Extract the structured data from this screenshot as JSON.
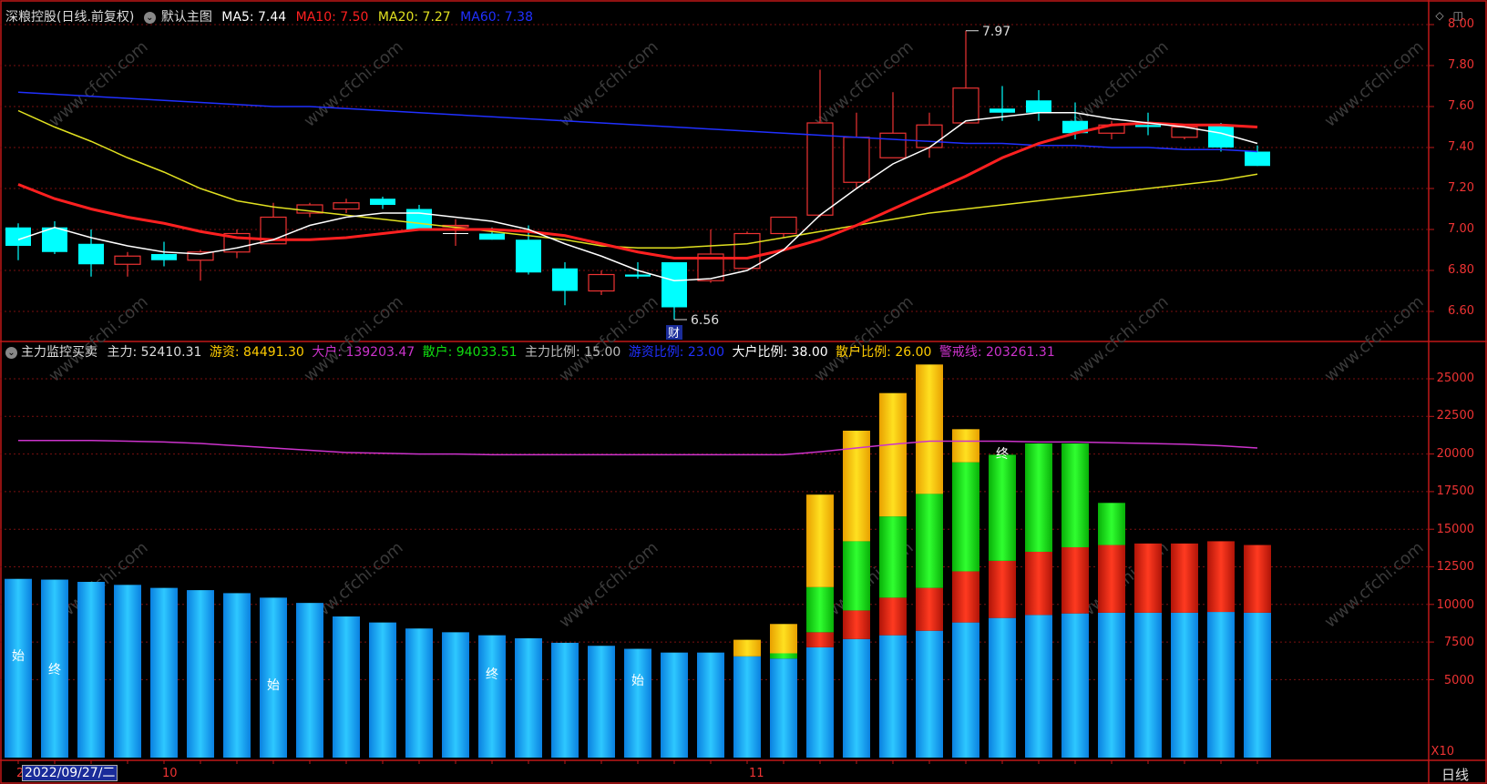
{
  "header": {
    "stock": "深粮控股",
    "period_desc": "(日线.前复权)",
    "template": "默认主图",
    "ma5": "MA5: 7.44",
    "ma10": "MA10: 7.50",
    "ma20": "MA20: 7.27",
    "ma60": "MA60: 7.38"
  },
  "indicator": {
    "name": "主力监控买卖",
    "zhuli": "主力: 52410.31",
    "youzi": "游资: 84491.30",
    "dahu": "大户: 139203.47",
    "sanhu": "散户: 94033.51",
    "zhuli_ratio": "主力比例: 15.00",
    "youzi_ratio": "游资比例: 23.00",
    "dahu_ratio": "大户比例: 38.00",
    "sanhu_ratio": "散户比例: 26.00",
    "alert": "警戒线: 203261.31"
  },
  "price_axis": [
    "8.00",
    "7.80",
    "7.60",
    "7.40",
    "7.20",
    "7.00",
    "6.80",
    "6.60"
  ],
  "vol_axis": [
    "25000",
    "22500",
    "20000",
    "17500",
    "15000",
    "12500",
    "10000",
    "7500",
    "5000"
  ],
  "annotations": {
    "high": "7.97",
    "low": "6.56",
    "cai": "财",
    "start": "始",
    "end": "终",
    "x10": "X10"
  },
  "footer": {
    "date": "2022/09/27/二",
    "m1": "10",
    "m2": "11",
    "period": "日线",
    "left_mark": "2"
  },
  "watermark": "www.cfchi.com",
  "colors": {
    "up": "#e33",
    "down": "#00ffff",
    "ma5": "#ffffff",
    "ma10": "#ff2020",
    "ma20": "#e0e020",
    "ma60": "#2030ff",
    "main": "#1ea8ff",
    "red": "#e82010",
    "green": "#10dd10",
    "yellow": "#ffcc00",
    "alert": "#cc33cc"
  },
  "chart_data": [
    {
      "type": "candlestick",
      "ylim": [
        6.5,
        8.05
      ],
      "candles": [
        {
          "o": 7.01,
          "h": 7.03,
          "l": 6.85,
          "c": 6.92
        },
        {
          "o": 7.01,
          "h": 7.04,
          "l": 6.88,
          "c": 6.89
        },
        {
          "o": 6.93,
          "h": 7.0,
          "l": 6.77,
          "c": 6.83
        },
        {
          "o": 6.83,
          "h": 6.89,
          "l": 6.77,
          "c": 6.87
        },
        {
          "o": 6.88,
          "h": 6.94,
          "l": 6.82,
          "c": 6.85
        },
        {
          "o": 6.85,
          "h": 6.9,
          "l": 6.75,
          "c": 6.89
        },
        {
          "o": 6.89,
          "h": 7.0,
          "l": 6.86,
          "c": 6.98
        },
        {
          "o": 6.93,
          "h": 7.13,
          "l": 6.93,
          "c": 7.06
        },
        {
          "o": 7.08,
          "h": 7.13,
          "l": 7.06,
          "c": 7.12
        },
        {
          "o": 7.1,
          "h": 7.15,
          "l": 7.08,
          "c": 7.13
        },
        {
          "o": 7.15,
          "h": 7.16,
          "l": 7.1,
          "c": 7.12
        },
        {
          "o": 7.1,
          "h": 7.12,
          "l": 7.0,
          "c": 7.0
        },
        {
          "o": 7.02,
          "h": 7.05,
          "l": 6.92,
          "c": 7.02
        },
        {
          "o": 6.98,
          "h": 7.01,
          "l": 6.95,
          "c": 6.95
        },
        {
          "o": 6.95,
          "h": 7.02,
          "l": 6.78,
          "c": 6.79
        },
        {
          "o": 6.81,
          "h": 6.84,
          "l": 6.63,
          "c": 6.7
        },
        {
          "o": 6.7,
          "h": 6.8,
          "l": 6.68,
          "c": 6.78
        },
        {
          "o": 6.78,
          "h": 6.84,
          "l": 6.76,
          "c": 6.77
        },
        {
          "o": 6.84,
          "h": 6.84,
          "l": 6.56,
          "c": 6.62
        },
        {
          "o": 6.75,
          "h": 7.0,
          "l": 6.74,
          "c": 6.88
        },
        {
          "o": 6.81,
          "h": 6.99,
          "l": 6.81,
          "c": 6.98
        },
        {
          "o": 6.98,
          "h": 7.06,
          "l": 6.96,
          "c": 7.06
        },
        {
          "o": 7.07,
          "h": 7.78,
          "l": 7.06,
          "c": 7.52
        },
        {
          "o": 7.23,
          "h": 7.57,
          "l": 7.2,
          "c": 7.45
        },
        {
          "o": 7.35,
          "h": 7.67,
          "l": 7.35,
          "c": 7.47
        },
        {
          "o": 7.4,
          "h": 7.57,
          "l": 7.35,
          "c": 7.51
        },
        {
          "o": 7.52,
          "h": 7.97,
          "l": 7.52,
          "c": 7.69
        },
        {
          "o": 7.59,
          "h": 7.7,
          "l": 7.53,
          "c": 7.57
        },
        {
          "o": 7.63,
          "h": 7.68,
          "l": 7.53,
          "c": 7.57
        },
        {
          "o": 7.53,
          "h": 7.62,
          "l": 7.44,
          "c": 7.47
        },
        {
          "o": 7.47,
          "h": 7.53,
          "l": 7.44,
          "c": 7.51
        },
        {
          "o": 7.51,
          "h": 7.57,
          "l": 7.46,
          "c": 7.5
        },
        {
          "o": 7.45,
          "h": 7.51,
          "l": 7.44,
          "c": 7.5
        },
        {
          "o": 7.51,
          "h": 7.52,
          "l": 7.38,
          "c": 7.4
        },
        {
          "o": 7.38,
          "h": 7.41,
          "l": 7.31,
          "c": 7.31
        }
      ],
      "ma5": [
        6.95,
        7.01,
        6.96,
        6.92,
        6.89,
        6.88,
        6.91,
        6.95,
        7.02,
        7.06,
        7.08,
        7.08,
        7.06,
        7.04,
        7.0,
        6.93,
        6.87,
        6.8,
        6.75,
        6.76,
        6.8,
        6.9,
        7.07,
        7.2,
        7.32,
        7.4,
        7.53,
        7.55,
        7.57,
        7.57,
        7.54,
        7.52,
        7.5,
        7.47,
        7.42
      ],
      "ma10": [
        7.22,
        7.15,
        7.1,
        7.06,
        7.03,
        6.99,
        6.96,
        6.95,
        6.95,
        6.96,
        6.98,
        7.0,
        7.0,
        7.0,
        6.99,
        6.97,
        6.93,
        6.89,
        6.86,
        6.86,
        6.86,
        6.9,
        6.95,
        7.02,
        7.1,
        7.18,
        7.26,
        7.35,
        7.42,
        7.47,
        7.51,
        7.52,
        7.51,
        7.51,
        7.5
      ],
      "ma20": [
        7.58,
        7.5,
        7.43,
        7.35,
        7.28,
        7.2,
        7.14,
        7.11,
        7.09,
        7.07,
        7.05,
        7.03,
        7.01,
        6.99,
        6.97,
        6.95,
        6.92,
        6.91,
        6.91,
        6.92,
        6.93,
        6.96,
        6.99,
        7.02,
        7.05,
        7.08,
        7.1,
        7.12,
        7.14,
        7.16,
        7.18,
        7.2,
        7.22,
        7.24,
        7.27
      ],
      "ma60": [
        7.67,
        7.66,
        7.65,
        7.64,
        7.63,
        7.62,
        7.61,
        7.6,
        7.6,
        7.59,
        7.58,
        7.57,
        7.56,
        7.55,
        7.54,
        7.53,
        7.52,
        7.51,
        7.5,
        7.49,
        7.48,
        7.47,
        7.46,
        7.45,
        7.44,
        7.43,
        7.42,
        7.42,
        7.41,
        7.41,
        7.4,
        7.4,
        7.39,
        7.39,
        7.38
      ]
    },
    {
      "type": "stacked-bar",
      "ylim": [
        0,
        26500
      ],
      "alert_line": 20800,
      "series": [
        {
          "name": "主力",
          "values": [
            11700,
            11650,
            11500,
            11300,
            11100,
            10950,
            10750,
            10450,
            10100,
            9200,
            8800,
            8400,
            8150,
            7950,
            7750,
            7450,
            7250,
            7050,
            6800,
            6800,
            6550,
            6400,
            7150,
            7700,
            7950,
            8250,
            8800,
            9100,
            9300,
            9400,
            9450,
            9450,
            9450,
            9500,
            9450
          ]
        },
        {
          "name": "大户",
          "values": [
            0,
            0,
            0,
            0,
            0,
            0,
            0,
            0,
            0,
            0,
            0,
            0,
            0,
            0,
            0,
            0,
            0,
            0,
            0,
            0,
            0,
            0,
            1000,
            1900,
            2500,
            2850,
            3400,
            3800,
            4200,
            4400,
            4500,
            4600,
            4600,
            4700,
            4500
          ]
        },
        {
          "name": "散户",
          "values": [
            0,
            0,
            0,
            0,
            0,
            0,
            0,
            0,
            0,
            0,
            0,
            0,
            0,
            0,
            0,
            0,
            0,
            0,
            0,
            0,
            0,
            350,
            3000,
            4600,
            5400,
            6250,
            7250,
            7050,
            7200,
            6900,
            2800,
            0,
            0,
            0,
            0
          ]
        },
        {
          "name": "游资",
          "values": [
            0,
            0,
            0,
            0,
            0,
            0,
            0,
            0,
            0,
            0,
            0,
            0,
            0,
            0,
            0,
            0,
            0,
            0,
            0,
            0,
            1100,
            1950,
            6150,
            7350,
            8200,
            8600,
            2200,
            0,
            0,
            0,
            0,
            0,
            0,
            0,
            0
          ]
        }
      ],
      "alert_values": [
        20900,
        20900,
        20900,
        20850,
        20800,
        20700,
        20550,
        20400,
        20250,
        20100,
        20050,
        20000,
        20000,
        19950,
        19950,
        19950,
        19950,
        19950,
        19950,
        19950,
        19950,
        19950,
        20150,
        20400,
        20650,
        20850,
        20850,
        20850,
        20800,
        20800,
        20750,
        20700,
        20650,
        20550,
        20400
      ],
      "markers": [
        {
          "i": 0,
          "t": "始"
        },
        {
          "i": 1,
          "t": "终"
        },
        {
          "i": 7,
          "t": "始"
        },
        {
          "i": 13,
          "t": "终"
        },
        {
          "i": 17,
          "t": "始"
        },
        {
          "i": 27,
          "t": "终"
        }
      ]
    }
  ]
}
